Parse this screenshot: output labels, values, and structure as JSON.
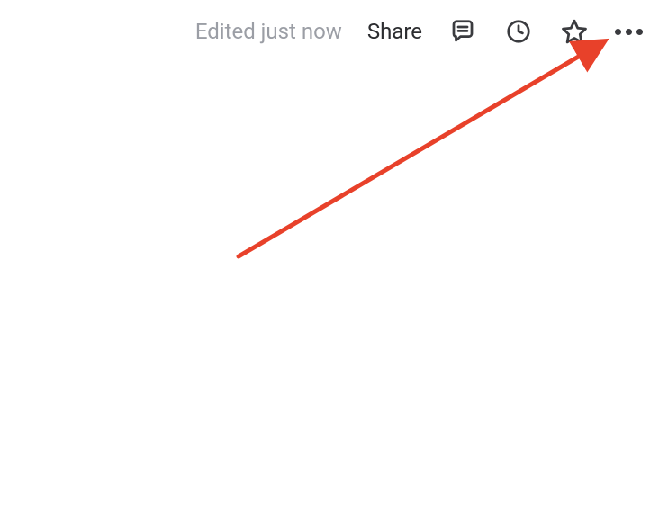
{
  "toolbar": {
    "edit_status": "Edited just now",
    "share_label": "Share"
  },
  "annotation": {
    "color": "#e8412a"
  }
}
